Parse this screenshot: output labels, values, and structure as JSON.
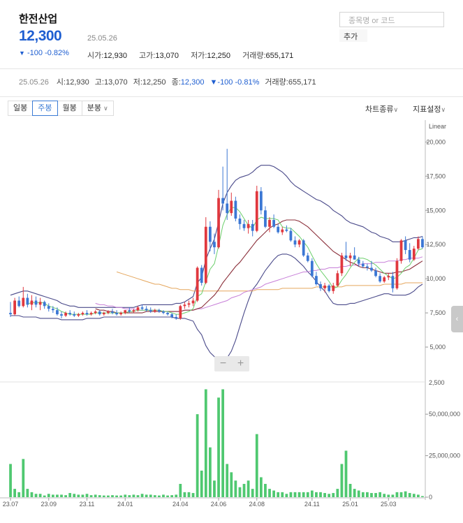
{
  "stock": {
    "name": "한전산업",
    "price": "12,300",
    "date": "25.05.26",
    "change": "-100",
    "change_pct": "-0.82%",
    "change_arrow": "▼",
    "ohlc": [
      {
        "label": "시가",
        "value": "12,930"
      },
      {
        "label": "고가",
        "value": "13,070"
      },
      {
        "label": "저가",
        "value": "12,250"
      },
      {
        "label": "거래량",
        "value": "655,171"
      }
    ]
  },
  "search": {
    "placeholder": "종목명 or 코드",
    "add_label": "추가"
  },
  "info_row": {
    "date": "25.05.26",
    "open_label": "시",
    "open": "12,930",
    "high_label": "고",
    "high": "13,070",
    "low_label": "저",
    "low": "12,250",
    "close_label": "종",
    "close": "12,300",
    "change_arrow": "▼",
    "change": "-100",
    "change_pct": "-0.81%",
    "volume_label": "거래량",
    "volume": "655,171"
  },
  "tabs": [
    "일봉",
    "주봉",
    "월봉",
    "분봉"
  ],
  "active_tab": "주봉",
  "tab_dropdown_arrow": "∨",
  "right_menu": {
    "chart_type": "차트종류",
    "indicator": "지표설정",
    "arrow": "∨"
  },
  "zoom": {
    "minus": "−",
    "plus": "+"
  },
  "side_handle": "‹",
  "colors": {
    "up": "#e0383e",
    "down": "#3b77d4",
    "volume": "#4fc870",
    "ma5": "#6bcf6b",
    "ma20": "#8b2f3a",
    "ma60": "#c77ed8",
    "ma120": "#e5a65c",
    "band": "#4a4a8a"
  },
  "chart_data": {
    "type": "candlestick",
    "scale_label": "Linear",
    "price_axis": {
      "ticks": [
        5000,
        7500,
        10000,
        12500,
        15000,
        17500,
        20000
      ],
      "tick_labels": [
        "5,000",
        "7,500",
        "10,000",
        "12,500",
        "15,000",
        "17,500",
        "20,000"
      ],
      "range": [
        2500,
        21500
      ]
    },
    "volume_axis": {
      "ticks": [
        0,
        25000000,
        50000000
      ],
      "tick_labels": [
        "0",
        "25,000,000",
        "50,000,000"
      ],
      "range": [
        0,
        69000000
      ],
      "top_label": "2,500"
    },
    "x_ticks": [
      {
        "label": "23.07",
        "index": 0
      },
      {
        "label": "23.09",
        "index": 9
      },
      {
        "label": "23.11",
        "index": 18
      },
      {
        "label": "24.01",
        "index": 27
      },
      {
        "label": "24.04",
        "index": 40
      },
      {
        "label": "24.06",
        "index": 49
      },
      {
        "label": "24.08",
        "index": 58
      },
      {
        "label": "24.11",
        "index": 71
      },
      {
        "label": "25.01",
        "index": 80
      },
      {
        "label": "25.03",
        "index": 89
      }
    ],
    "candles": [
      [
        7500,
        8300,
        7200,
        7400,
        20000000
      ],
      [
        7400,
        8600,
        7300,
        8400,
        5000000
      ],
      [
        8400,
        8700,
        7900,
        8000,
        3000000
      ],
      [
        8000,
        9400,
        7900,
        8600,
        23000000
      ],
      [
        8600,
        8900,
        7900,
        8100,
        5000000
      ],
      [
        8100,
        8800,
        7700,
        8400,
        3000000
      ],
      [
        8400,
        8700,
        7900,
        8100,
        2000000
      ],
      [
        8100,
        8600,
        7700,
        8300,
        2000000
      ],
      [
        8300,
        8400,
        7800,
        8000,
        1000000
      ],
      [
        8000,
        8200,
        7600,
        7800,
        2000000
      ],
      [
        7800,
        8000,
        7500,
        7700,
        1500000
      ],
      [
        7700,
        7900,
        7300,
        7400,
        1500000
      ],
      [
        7400,
        7600,
        7100,
        7300,
        1500000
      ],
      [
        7300,
        7600,
        7200,
        7500,
        1200000
      ],
      [
        7500,
        7700,
        7300,
        7400,
        2500000
      ],
      [
        7400,
        7600,
        7200,
        7300,
        2000000
      ],
      [
        7300,
        7500,
        7200,
        7400,
        1500000
      ],
      [
        7400,
        7600,
        7300,
        7500,
        1500000
      ],
      [
        7500,
        7700,
        7300,
        7400,
        2000000
      ],
      [
        7400,
        7600,
        7300,
        7500,
        1200000
      ],
      [
        7500,
        7700,
        7400,
        7600,
        1500000
      ],
      [
        7600,
        7700,
        7300,
        7400,
        1200000
      ],
      [
        7400,
        7600,
        7300,
        7500,
        1000000
      ],
      [
        7500,
        7700,
        7400,
        7600,
        1000000
      ],
      [
        7600,
        7800,
        7400,
        7500,
        1200000
      ],
      [
        7500,
        7700,
        7300,
        7400,
        1000000
      ],
      [
        7400,
        7600,
        7300,
        7500,
        1000000
      ],
      [
        7500,
        7700,
        7400,
        7700,
        1500000
      ],
      [
        7700,
        7900,
        7500,
        7600,
        1200000
      ],
      [
        7600,
        7800,
        7500,
        7700,
        1500000
      ],
      [
        7700,
        8000,
        7600,
        7900,
        1200000
      ],
      [
        7900,
        8100,
        7700,
        7800,
        2000000
      ],
      [
        7800,
        8000,
        7600,
        7700,
        1500000
      ],
      [
        7700,
        7900,
        7500,
        7600,
        1500000
      ],
      [
        7600,
        7800,
        7500,
        7700,
        1200000
      ],
      [
        7700,
        7800,
        7500,
        7600,
        1000000
      ],
      [
        7600,
        7700,
        7400,
        7500,
        1500000
      ],
      [
        7500,
        7600,
        7300,
        7400,
        1000000
      ],
      [
        7400,
        7500,
        7100,
        7200,
        1200000
      ],
      [
        7200,
        7400,
        7000,
        7100,
        1500000
      ],
      [
        7100,
        8100,
        7000,
        8000,
        8000000
      ],
      [
        8000,
        8300,
        7800,
        8100,
        3000000
      ],
      [
        8100,
        8400,
        7900,
        8200,
        3000000
      ],
      [
        8200,
        8600,
        8000,
        8400,
        2500000
      ],
      [
        8400,
        10900,
        8300,
        10800,
        50000000
      ],
      [
        10800,
        11000,
        9500,
        9700,
        16000000
      ],
      [
        9700,
        14500,
        9600,
        13800,
        65000000
      ],
      [
        13800,
        14200,
        12000,
        12700,
        30000000
      ],
      [
        12700,
        13300,
        11800,
        12300,
        10000000
      ],
      [
        12300,
        16500,
        12200,
        15900,
        60000000
      ],
      [
        15900,
        18200,
        15000,
        15500,
        65000000
      ],
      [
        15500,
        19500,
        14300,
        14800,
        20000000
      ],
      [
        14800,
        16300,
        14600,
        15700,
        15000000
      ],
      [
        15700,
        16000,
        14200,
        14400,
        10000000
      ],
      [
        14400,
        14700,
        13600,
        14000,
        6000000
      ],
      [
        14000,
        14300,
        13500,
        13700,
        8000000
      ],
      [
        13700,
        14300,
        13300,
        14000,
        10000000
      ],
      [
        14000,
        14300,
        13100,
        13500,
        5000000
      ],
      [
        13500,
        16800,
        13400,
        16400,
        38000000
      ],
      [
        16400,
        16700,
        14700,
        15000,
        12000000
      ],
      [
        15000,
        15300,
        13700,
        13800,
        8000000
      ],
      [
        13800,
        14500,
        13400,
        14300,
        5000000
      ],
      [
        14300,
        14700,
        13700,
        13800,
        4000000
      ],
      [
        13800,
        14000,
        13300,
        13400,
        3000000
      ],
      [
        13400,
        13800,
        13200,
        13600,
        3000000
      ],
      [
        13600,
        13900,
        13400,
        13500,
        2000000
      ],
      [
        13500,
        13700,
        12700,
        12800,
        3000000
      ],
      [
        12800,
        13100,
        12300,
        12500,
        3000000
      ],
      [
        12500,
        12900,
        12300,
        12800,
        3000000
      ],
      [
        12800,
        12900,
        11600,
        11700,
        3000000
      ],
      [
        11700,
        11900,
        11200,
        11300,
        3000000
      ],
      [
        11300,
        11500,
        10100,
        10200,
        4000000
      ],
      [
        10200,
        10500,
        9500,
        9600,
        3000000
      ],
      [
        9600,
        9800,
        9100,
        9300,
        3000000
      ],
      [
        9300,
        9700,
        9000,
        9500,
        2500000
      ],
      [
        9500,
        9600,
        9000,
        9100,
        2000000
      ],
      [
        9100,
        9700,
        8900,
        9500,
        2500000
      ],
      [
        9500,
        10600,
        9400,
        10400,
        5000000
      ],
      [
        10400,
        11900,
        10200,
        11700,
        20000000
      ],
      [
        11700,
        12700,
        11300,
        11500,
        28000000
      ],
      [
        11500,
        11900,
        10900,
        11700,
        8000000
      ],
      [
        11700,
        12300,
        11400,
        11400,
        5000000
      ],
      [
        11400,
        11600,
        10900,
        11100,
        4000000
      ],
      [
        11100,
        11300,
        10800,
        10900,
        3000000
      ],
      [
        10900,
        11100,
        10600,
        10800,
        3000000
      ],
      [
        10800,
        11300,
        10500,
        10600,
        2500000
      ],
      [
        10600,
        10800,
        10100,
        10200,
        2500000
      ],
      [
        10200,
        10400,
        9700,
        9800,
        3000000
      ],
      [
        9800,
        10200,
        9700,
        10100,
        2000000
      ],
      [
        10100,
        10400,
        9900,
        10200,
        1500000
      ],
      [
        10200,
        10500,
        9000,
        9300,
        1500000
      ],
      [
        9300,
        11500,
        9200,
        11300,
        3000000
      ],
      [
        11300,
        12900,
        11100,
        12800,
        3000000
      ],
      [
        12800,
        13100,
        11800,
        12100,
        3500000
      ],
      [
        12100,
        12600,
        11200,
        11400,
        2500000
      ],
      [
        11400,
        12400,
        11300,
        12200,
        2000000
      ],
      [
        12200,
        13100,
        12100,
        12900,
        1500000
      ],
      [
        12900,
        13100,
        12200,
        12300,
        655171
      ]
    ],
    "ma5": [
      null,
      null,
      null,
      null,
      8100,
      8300,
      8200,
      8300,
      8200,
      8000,
      7900,
      7800,
      7600,
      7500,
      7400,
      7400,
      7400,
      7400,
      7400,
      7400,
      7500,
      7500,
      7500,
      7500,
      7500,
      7500,
      7500,
      7500,
      7600,
      7600,
      7700,
      7700,
      7700,
      7700,
      7700,
      7700,
      7600,
      7600,
      7500,
      7400,
      7400,
      7500,
      7600,
      7800,
      8700,
      8900,
      9800,
      10700,
      11100,
      12400,
      13900,
      14700,
      15200,
      15200,
      14900,
      14400,
      13900,
      13700,
      14300,
      14500,
      14400,
      14400,
      14400,
      14300,
      13800,
      13700,
      13700,
      13400,
      13100,
      12700,
      12300,
      11700,
      11100,
      10600,
      10200,
      9800,
      9300,
      9400,
      9900,
      10300,
      10800,
      11200,
      11500,
      11500,
      11400,
      11200,
      11000,
      10700,
      10400,
      10200,
      10000,
      10100,
      10400,
      10800,
      11000,
      11500,
      12100,
      12200
    ],
    "ma20": [
      null,
      null,
      null,
      null,
      null,
      null,
      null,
      null,
      null,
      null,
      null,
      null,
      null,
      null,
      null,
      null,
      null,
      null,
      null,
      null,
      7800,
      7700,
      7700,
      7600,
      7600,
      7500,
      7500,
      7500,
      7500,
      7500,
      7500,
      7500,
      7600,
      7600,
      7600,
      7600,
      7600,
      7600,
      7600,
      7600,
      7600,
      7700,
      7700,
      7700,
      7800,
      7900,
      8200,
      8500,
      8800,
      9200,
      9700,
      10100,
      10500,
      10900,
      11200,
      11600,
      12000,
      12400,
      12800,
      13100,
      13400,
      13700,
      13900,
      14000,
      14200,
      14300,
      14300,
      14300,
      14200,
      14000,
      13800,
      13500,
      13200,
      12900,
      12600,
      12300,
      12000,
      11800,
      11600,
      11400,
      11200,
      11100,
      10900,
      10800,
      10800,
      10700,
      10600,
      10500,
      10400,
      10400,
      10400,
      10500,
      10500,
      10600,
      10700,
      10900,
      11100,
      11300
    ],
    "ma60": [
      null,
      null,
      null,
      null,
      null,
      null,
      null,
      null,
      null,
      null,
      null,
      null,
      null,
      null,
      null,
      null,
      null,
      null,
      null,
      null,
      8200,
      8100,
      8100,
      8000,
      8000,
      7900,
      7900,
      7800,
      7800,
      7800,
      7700,
      7700,
      7700,
      7700,
      7700,
      7700,
      7600,
      7600,
      7600,
      7600,
      7600,
      7700,
      7700,
      7700,
      7800,
      7800,
      7900,
      8000,
      8100,
      8200,
      8300,
      8400,
      8600,
      8700,
      8800,
      9000,
      9100,
      9200,
      9300,
      9400,
      9600,
      9700,
      9800,
      9900,
      10000,
      10100,
      10200,
      10300,
      10400,
      10500,
      10500,
      10600,
      10600,
      10700,
      10700,
      10800,
      10800,
      10800,
      10900,
      10900,
      11000,
      11000,
      11000,
      11100,
      11100,
      11100,
      11200,
      11200,
      11200,
      11300,
      11300,
      11300,
      11400,
      11400,
      11500,
      11500,
      11500,
      11600
    ],
    "ma120": [
      null,
      null,
      null,
      null,
      null,
      null,
      null,
      null,
      null,
      null,
      null,
      null,
      null,
      null,
      null,
      null,
      null,
      null,
      null,
      null,
      null,
      null,
      null,
      null,
      null,
      10500,
      10400,
      10300,
      10200,
      10100,
      10000,
      9900,
      9800,
      9700,
      9600,
      9600,
      9500,
      9400,
      9300,
      9300,
      9200,
      9200,
      9200,
      9100,
      9100,
      9100,
      9100,
      9100,
      9100,
      9100,
      9100,
      9100,
      9100,
      9100,
      9100,
      9100,
      9100,
      9100,
      9200,
      9200,
      9200,
      9200,
      9200,
      9200,
      9300,
      9300,
      9300,
      9300,
      9300,
      9300,
      9300,
      9300,
      9400,
      9400,
      9400,
      9400,
      9400,
      9400,
      9400,
      9500,
      9500,
      9500,
      9500,
      9500,
      9500,
      9500,
      9500,
      9500,
      9600,
      9600,
      9600,
      9600,
      9600,
      9700,
      9700,
      9700,
      9700,
      9700
    ],
    "bb_upper": [
      8800,
      8900,
      9000,
      9100,
      9100,
      9000,
      8900,
      8800,
      8700,
      8600,
      8500,
      8400,
      8200,
      8100,
      8000,
      8000,
      7900,
      7900,
      7900,
      7900,
      7900,
      7900,
      7900,
      7900,
      7900,
      7900,
      7900,
      7900,
      7900,
      7900,
      8000,
      8100,
      8100,
      8100,
      8100,
      8100,
      8100,
      8100,
      8100,
      8200,
      8200,
      8300,
      8500,
      8700,
      9700,
      10100,
      11400,
      12200,
      12900,
      14100,
      15500,
      16300,
      16800,
      17200,
      17400,
      17500,
      17600,
      17800,
      18100,
      18300,
      18300,
      18300,
      18200,
      18000,
      17800,
      17500,
      17100,
      16800,
      16600,
      16400,
      16200,
      16000,
      15800,
      15700,
      15500,
      15300,
      15000,
      14800,
      14600,
      14300,
      14100,
      14000,
      13900,
      13800,
      13600,
      13400,
      13300,
      13100,
      13000,
      12900,
      12700,
      12700,
      12700,
      12800,
      12900,
      13000,
      13000,
      13100
    ],
    "bb_lower": [
      7300,
      7300,
      7300,
      7200,
      7200,
      7200,
      7200,
      7100,
      7100,
      7100,
      7100,
      7100,
      7000,
      7000,
      7000,
      7000,
      7000,
      7000,
      7100,
      7100,
      7100,
      7100,
      7200,
      7200,
      7200,
      7200,
      7200,
      7200,
      7200,
      7200,
      7200,
      7200,
      7200,
      7200,
      7200,
      7200,
      7200,
      7200,
      7200,
      7100,
      7100,
      7100,
      7000,
      6900,
      6300,
      5900,
      5100,
      4600,
      4300,
      4100,
      4000,
      4200,
      4700,
      5500,
      6500,
      7500,
      8400,
      9200,
      9600,
      10100,
      10600,
      11000,
      11400,
      11700,
      11800,
      11800,
      11700,
      11500,
      11200,
      10900,
      10500,
      10200,
      9800,
      9400,
      9100,
      8600,
      8200,
      8100,
      8100,
      8100,
      8200,
      8200,
      8300,
      8400,
      8500,
      8600,
      8700,
      8800,
      8900,
      8900,
      8800,
      8800,
      8800,
      8800,
      8900,
      9100,
      9400,
      9600
    ]
  }
}
